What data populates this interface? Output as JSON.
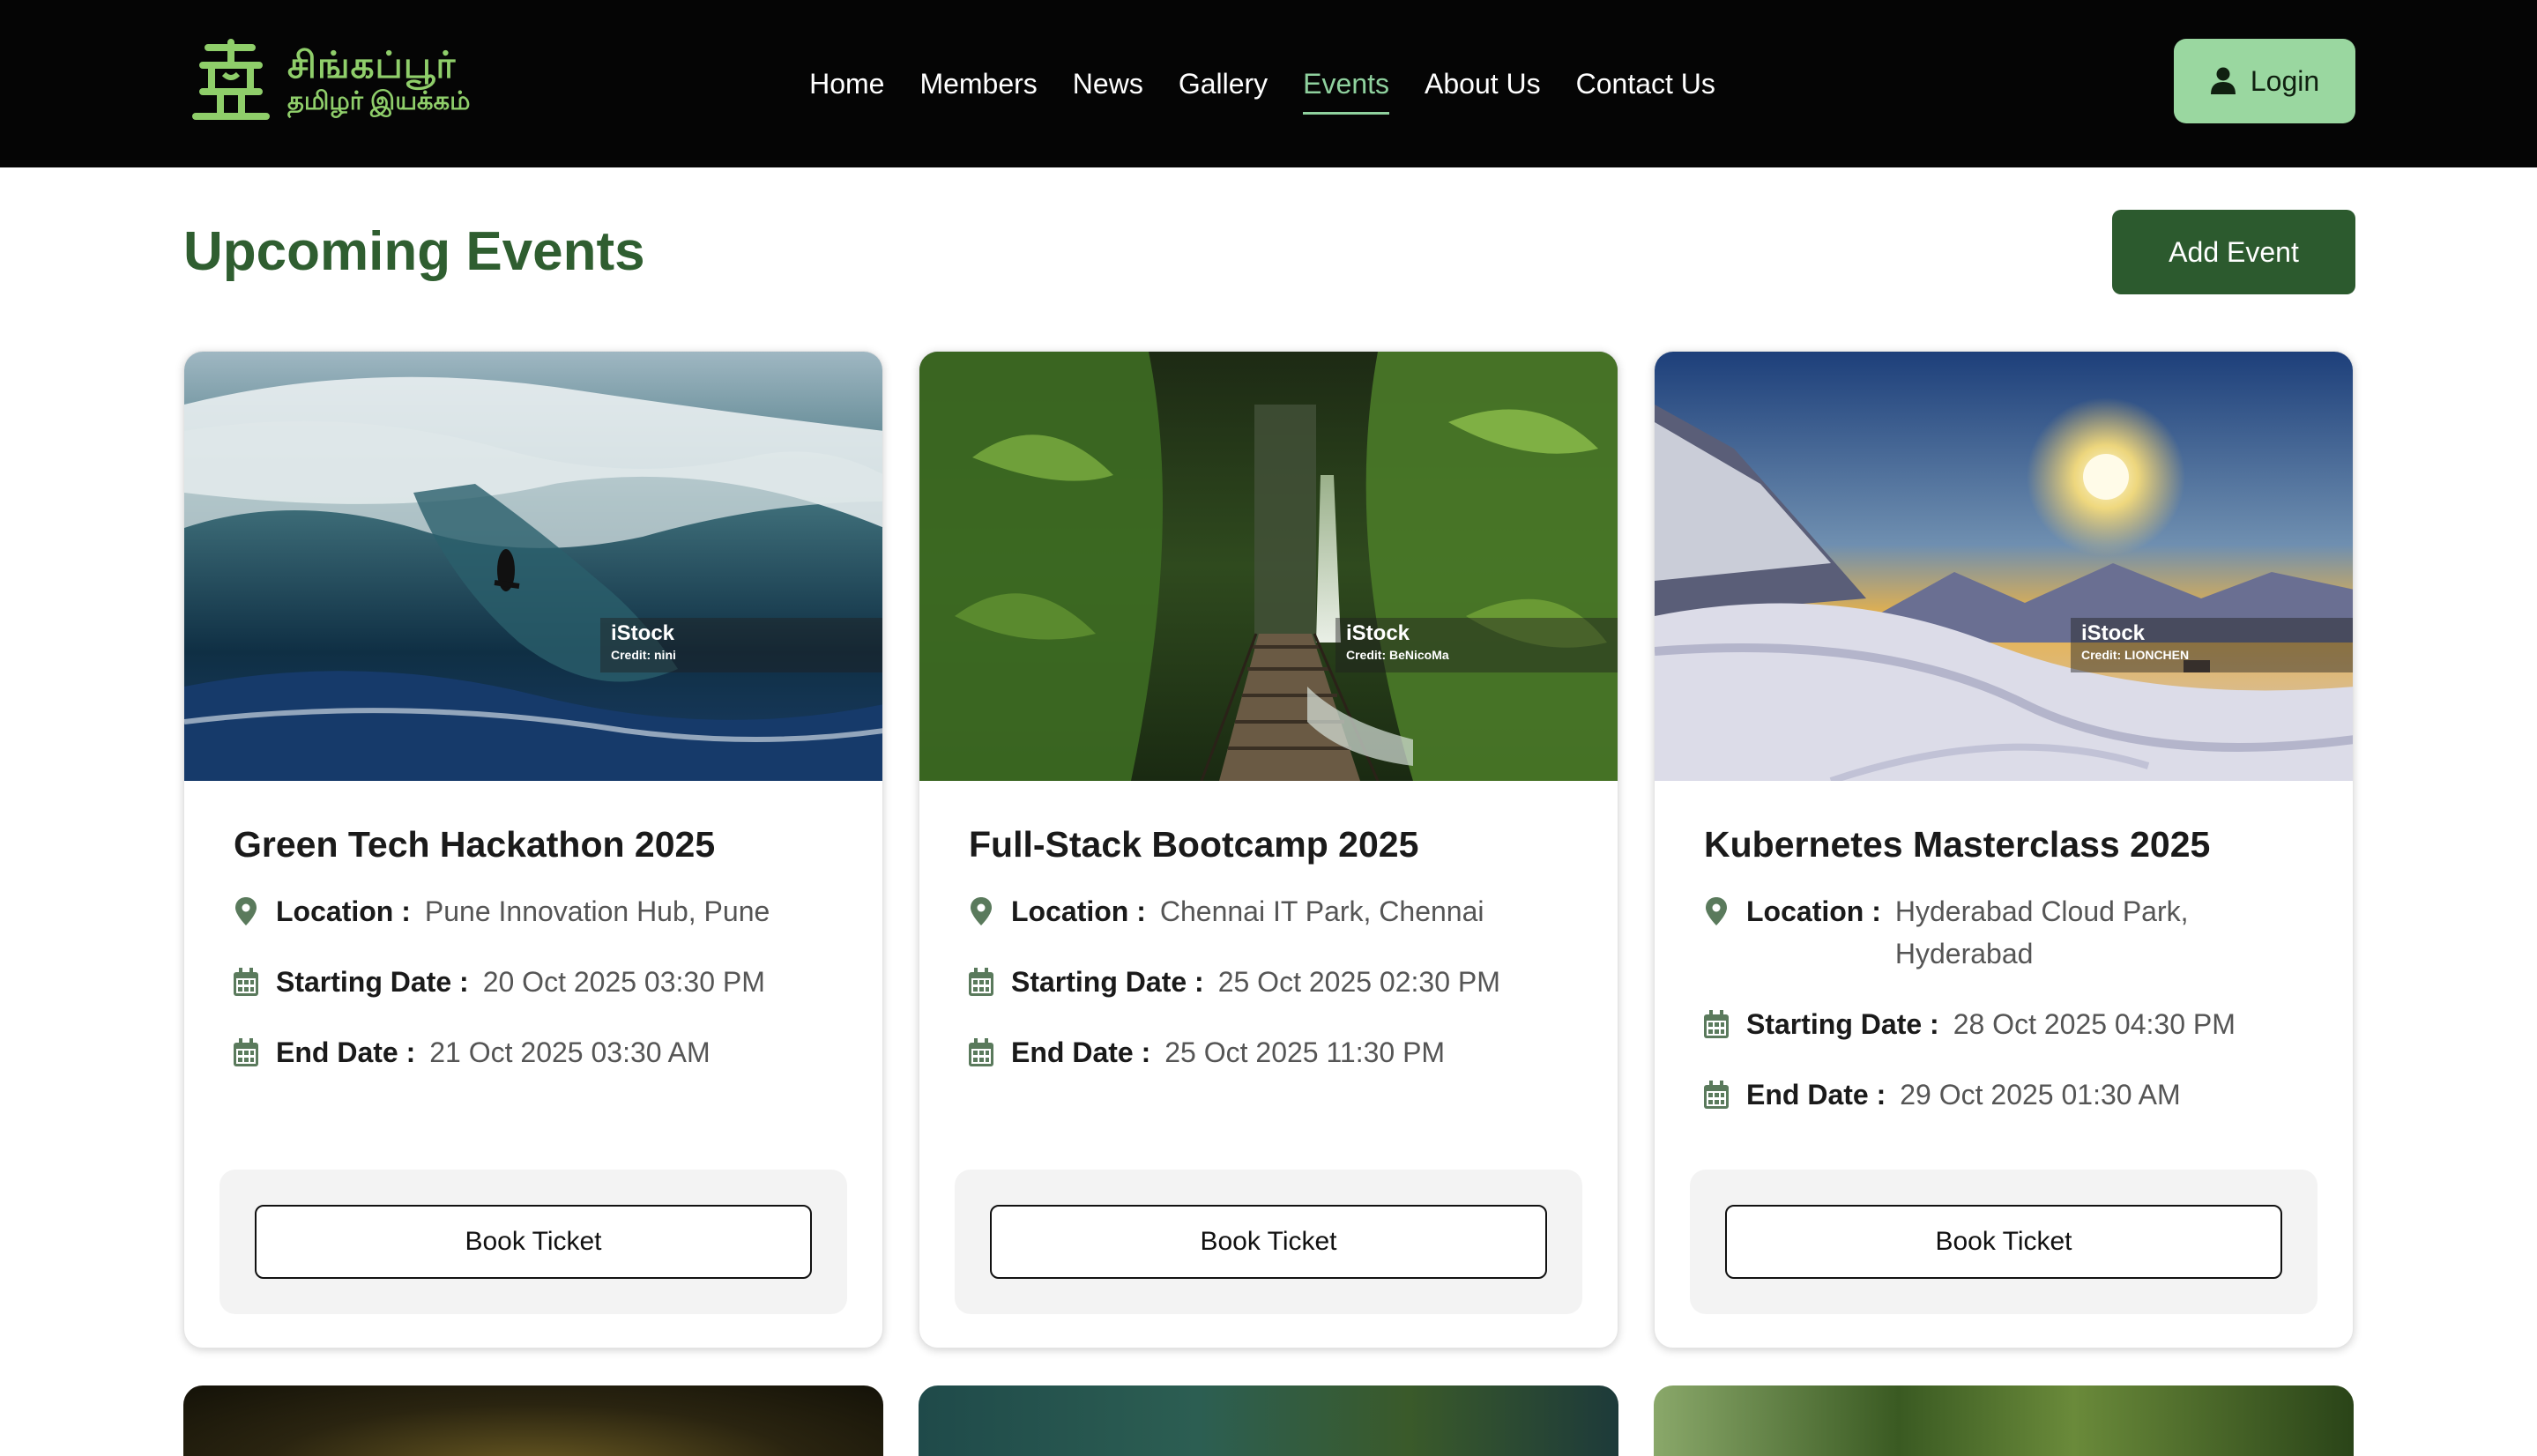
{
  "header": {
    "logo": {
      "line1": "சிங்கப்பூர்",
      "line2": "தமிழர் இயக்கம்"
    },
    "nav": [
      {
        "label": "Home",
        "active": false
      },
      {
        "label": "Members",
        "active": false
      },
      {
        "label": "News",
        "active": false
      },
      {
        "label": "Gallery",
        "active": false
      },
      {
        "label": "Events",
        "active": true
      },
      {
        "label": "About Us",
        "active": false
      },
      {
        "label": "Contact Us",
        "active": false
      }
    ],
    "login_label": "Login",
    "login_icon": "user-icon"
  },
  "page": {
    "title": "Upcoming Events",
    "add_event_label": "Add Event"
  },
  "colors": {
    "header_bg": "#050505",
    "accent_green": "#9ad7a0",
    "dark_green": "#2c5a2e",
    "title_green": "#2f5e30"
  },
  "labels": {
    "location": "Location :",
    "start": "Starting Date :",
    "end": "End Date :",
    "book": "Book Ticket"
  },
  "events": [
    {
      "title": "Green Tech Hackathon 2025",
      "location": "Pune Innovation Hub, Pune",
      "start": "20 Oct 2025 03:30 PM",
      "end": "21 Oct 2025 03:30 AM",
      "image": "surfer-wave-photo",
      "watermark": {
        "brand": "iStock",
        "credit": "Credit: nini"
      }
    },
    {
      "title": "Full-Stack Bootcamp 2025",
      "location": "Chennai IT Park, Chennai",
      "start": "25 Oct 2025 02:30 PM",
      "end": "25 Oct 2025 11:30 PM",
      "image": "jungle-bridge-waterfall-photo",
      "watermark": {
        "brand": "iStock",
        "credit": "Credit: BeNicoMa"
      }
    },
    {
      "title": "Kubernetes Masterclass 2025",
      "location": "Hyderabad Cloud Park, Hyderabad",
      "start": "28 Oct 2025 04:30 PM",
      "end": "29 Oct 2025 01:30 AM",
      "image": "snowy-mountain-sunset-photo",
      "watermark": {
        "brand": "iStock",
        "credit": "Credit: LIONCHEN"
      }
    }
  ]
}
